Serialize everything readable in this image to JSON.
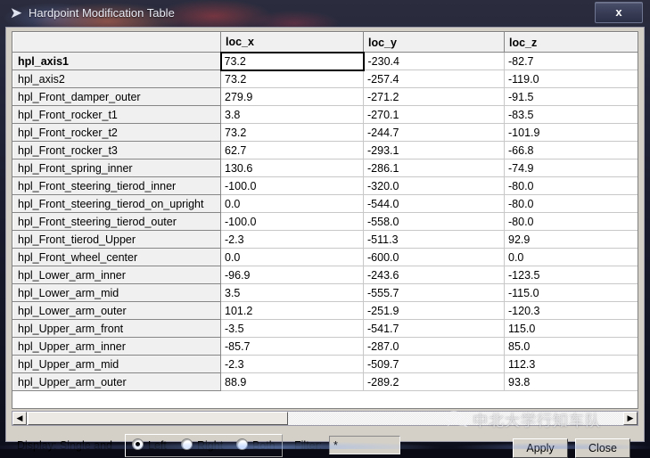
{
  "window": {
    "title": "Hardpoint Modification Table",
    "app_icon": "arrow-chevron-icon",
    "close_label": "x"
  },
  "table": {
    "columns": [
      "",
      "loc_x",
      "loc_y",
      "loc_z"
    ],
    "focused_cell": {
      "row": 0,
      "column": "loc_x"
    },
    "selected_row": 0,
    "rows": [
      {
        "name": "hpl_axis1",
        "loc_x": "73.2",
        "loc_y": "-230.4",
        "loc_z": "-82.7"
      },
      {
        "name": "hpl_axis2",
        "loc_x": "73.2",
        "loc_y": "-257.4",
        "loc_z": "-119.0"
      },
      {
        "name": "hpl_Front_damper_outer",
        "loc_x": "279.9",
        "loc_y": "-271.2",
        "loc_z": "-91.5"
      },
      {
        "name": "hpl_Front_rocker_t1",
        "loc_x": "3.8",
        "loc_y": "-270.1",
        "loc_z": "-83.5"
      },
      {
        "name": "hpl_Front_rocker_t2",
        "loc_x": "73.2",
        "loc_y": "-244.7",
        "loc_z": "-101.9"
      },
      {
        "name": "hpl_Front_rocker_t3",
        "loc_x": "62.7",
        "loc_y": "-293.1",
        "loc_z": "-66.8"
      },
      {
        "name": "hpl_Front_spring_inner",
        "loc_x": "130.6",
        "loc_y": "-286.1",
        "loc_z": "-74.9"
      },
      {
        "name": "hpl_Front_steering_tierod_inner",
        "loc_x": "-100.0",
        "loc_y": "-320.0",
        "loc_z": "-80.0"
      },
      {
        "name": "hpl_Front_steering_tierod_on_upright",
        "loc_x": "0.0",
        "loc_y": "-544.0",
        "loc_z": "-80.0"
      },
      {
        "name": "hpl_Front_steering_tierod_outer",
        "loc_x": "-100.0",
        "loc_y": "-558.0",
        "loc_z": "-80.0"
      },
      {
        "name": "hpl_Front_tierod_Upper",
        "loc_x": "-2.3",
        "loc_y": "-511.3",
        "loc_z": "92.9"
      },
      {
        "name": "hpl_Front_wheel_center",
        "loc_x": "0.0",
        "loc_y": "-600.0",
        "loc_z": "0.0"
      },
      {
        "name": "hpl_Lower_arm_inner",
        "loc_x": "-96.9",
        "loc_y": "-243.6",
        "loc_z": "-123.5"
      },
      {
        "name": "hpl_Lower_arm_mid",
        "loc_x": "3.5",
        "loc_y": "-555.7",
        "loc_z": "-115.0"
      },
      {
        "name": "hpl_Lower_arm_outer",
        "loc_x": "101.2",
        "loc_y": "-251.9",
        "loc_z": "-120.3"
      },
      {
        "name": "hpl_Upper_arm_front",
        "loc_x": "-3.5",
        "loc_y": "-541.7",
        "loc_z": "115.0"
      },
      {
        "name": "hpl_Upper_arm_inner",
        "loc_x": "-85.7",
        "loc_y": "-287.0",
        "loc_z": "85.0"
      },
      {
        "name": "hpl_Upper_arm_mid",
        "loc_x": "-2.3",
        "loc_y": "-509.7",
        "loc_z": "112.3"
      },
      {
        "name": "hpl_Upper_arm_outer",
        "loc_x": "88.9",
        "loc_y": "-289.2",
        "loc_z": "93.8"
      }
    ]
  },
  "scrollbar": {
    "left_arrow": "◀",
    "right_arrow": "▶"
  },
  "bottom": {
    "display_label": "Display:  Single and",
    "radios": [
      {
        "label": "Left",
        "selected": true
      },
      {
        "label": "Right",
        "selected": false
      },
      {
        "label": "Both",
        "selected": false
      }
    ],
    "filter_label": "Filter:",
    "filter_value": "*",
    "filter_placeholder": "*",
    "apply_label": "Apply",
    "close_label": "Close"
  },
  "watermark": {
    "text": "中北大学行知车队",
    "logo": "wechat-icon"
  },
  "colors": {
    "titlebar": "#1b1d2e",
    "dialog_face": "#d4d0c8",
    "header_face": "#f0f0f0",
    "cell_bg": "#ffffff",
    "focus_border": "#000000"
  }
}
